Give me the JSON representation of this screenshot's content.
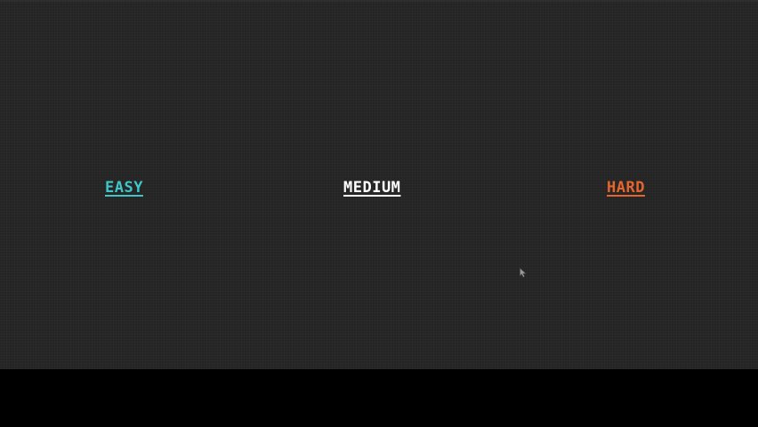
{
  "menu": {
    "options": [
      {
        "label": "Easy",
        "color": "#3ec6c9"
      },
      {
        "label": "Medium",
        "color": "#ffffff"
      },
      {
        "label": "Hard",
        "color": "#e5652e"
      }
    ]
  },
  "icons": {
    "cursor": "mouse-pointer-icon"
  }
}
